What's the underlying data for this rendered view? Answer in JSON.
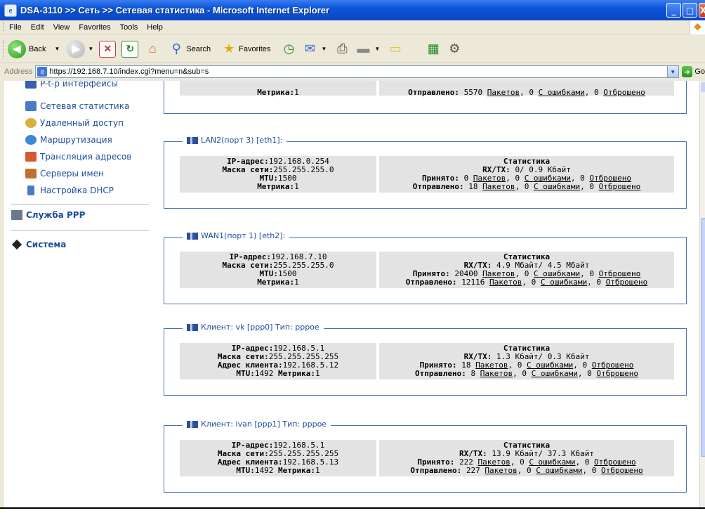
{
  "window": {
    "title": "DSA-3110 >> Сеть >> Сетевая статистика - Microsoft Internet Explorer",
    "min": "_",
    "max": "□",
    "close": "X"
  },
  "menu": [
    "File",
    "Edit",
    "View",
    "Favorites",
    "Tools",
    "Help"
  ],
  "toolbar": {
    "back": "Back",
    "search": "Search",
    "favorites": "Favorites"
  },
  "address": {
    "label": "Address",
    "url": "https://192.168.7.10/index.cgi?menu=n&sub=s",
    "go": "Go"
  },
  "sidebar": {
    "items": [
      {
        "label": "P-t-p интерфейсы",
        "color": "#3a5fb0"
      },
      {
        "label": "Сетевая статистика",
        "color": "#4a7ac8"
      },
      {
        "label": "Удаленный доступ",
        "color": "#d8b040"
      },
      {
        "label": "Маршрутизация",
        "color": "#3a8ad8"
      },
      {
        "label": "Трансляция адресов",
        "color": "#d85a30"
      },
      {
        "label": "Серверы имен",
        "color": "#c07030"
      },
      {
        "label": "Настройка DHCP",
        "color": "#4a7ac8"
      }
    ],
    "ppp": "Служба PPP",
    "system": "Система"
  },
  "top_partial": {
    "metric_label": "Метрика:",
    "metric_val": "1",
    "sent_label": "Отправлено:",
    "sent_val": "5570",
    "packets": "Пакетов",
    "err_count": "0",
    "errors": "С ошибками",
    "drop_count": "0",
    "dropped": "Отброшено"
  },
  "interfaces": [
    {
      "title": "LAN2(порт 3) [eth1]:",
      "ip_label": "IP-адрес:",
      "ip": "192.168.0.254",
      "mask_label": "Маска сети:",
      "mask": "255.255.255.0",
      "mtu_label": "MTU:",
      "mtu": "1500",
      "metric_label": "Метрика:",
      "metric": "1",
      "stats_title": "Статистика",
      "rxtx_label": "RX/TX:",
      "rxtx": "0/ 0.9 Кбайт",
      "recv_label": "Принято:",
      "recv": "0",
      "sent_label": "Отправлено:",
      "sent": "18",
      "packets": "Пакетов",
      "err_count": "0",
      "errors": "С ошибками",
      "drop_count": "0",
      "dropped": "Отброшено"
    },
    {
      "title": "WAN1(порт 1) [eth2]:",
      "ip_label": "IP-адрес:",
      "ip": "192.168.7.10",
      "mask_label": "Маска сети:",
      "mask": "255.255.255.0",
      "mtu_label": "MTU:",
      "mtu": "1500",
      "metric_label": "Метрика:",
      "metric": "1",
      "stats_title": "Статистика",
      "rxtx_label": "RX/TX:",
      "rxtx": "4.9 Мбайт/ 4.5 Мбайт",
      "recv_label": "Принято:",
      "recv": "20400",
      "sent_label": "Отправлено:",
      "sent": "12116",
      "packets": "Пакетов",
      "err_count": "0",
      "errors": "С ошибками",
      "drop_count": "0",
      "dropped": "Отброшено"
    }
  ],
  "clients": [
    {
      "title": "Клиент: vk [ppp0] Тип: pppoe",
      "ip_label": "IP-адрес:",
      "ip": "192.168.5.1",
      "mask_label": "Маска сети:",
      "mask": "255.255.255.255",
      "client_label": "Адрес клиента:",
      "client": "192.168.5.12",
      "mtu_label": "MTU:",
      "mtu": "1492",
      "metric_label": "Метрика:",
      "metric": "1",
      "stats_title": "Статистика",
      "rxtx_label": "RX/TX:",
      "rxtx": "1.3 Кбайт/ 0.3 Кбайт",
      "recv_label": "Принято:",
      "recv": "18",
      "sent_label": "Отправлено:",
      "sent": "8",
      "packets": "Пакетов",
      "err_count": "0",
      "errors": "С ошибками",
      "drop_count": "0",
      "dropped": "Отброшено"
    },
    {
      "title": "Клиент: ivan [ppp1] Тип: pppoe",
      "ip_label": "IP-адрес:",
      "ip": "192.168.5.1",
      "mask_label": "Маска сети:",
      "mask": "255.255.255.255",
      "client_label": "Адрес клиента:",
      "client": "192.168.5.13",
      "mtu_label": "MTU:",
      "mtu": "1492",
      "metric_label": "Метрика:",
      "metric": "1",
      "stats_title": "Статистика",
      "rxtx_label": "RX/TX:",
      "rxtx": "13.9 Кбайт/ 37.3 Кбайт",
      "recv_label": "Принято:",
      "recv": "222",
      "sent_label": "Отправлено:",
      "sent": "227",
      "packets": "Пакетов",
      "err_count": "0",
      "errors": "С ошибками",
      "drop_count": "0",
      "dropped": "Отброшено"
    }
  ]
}
